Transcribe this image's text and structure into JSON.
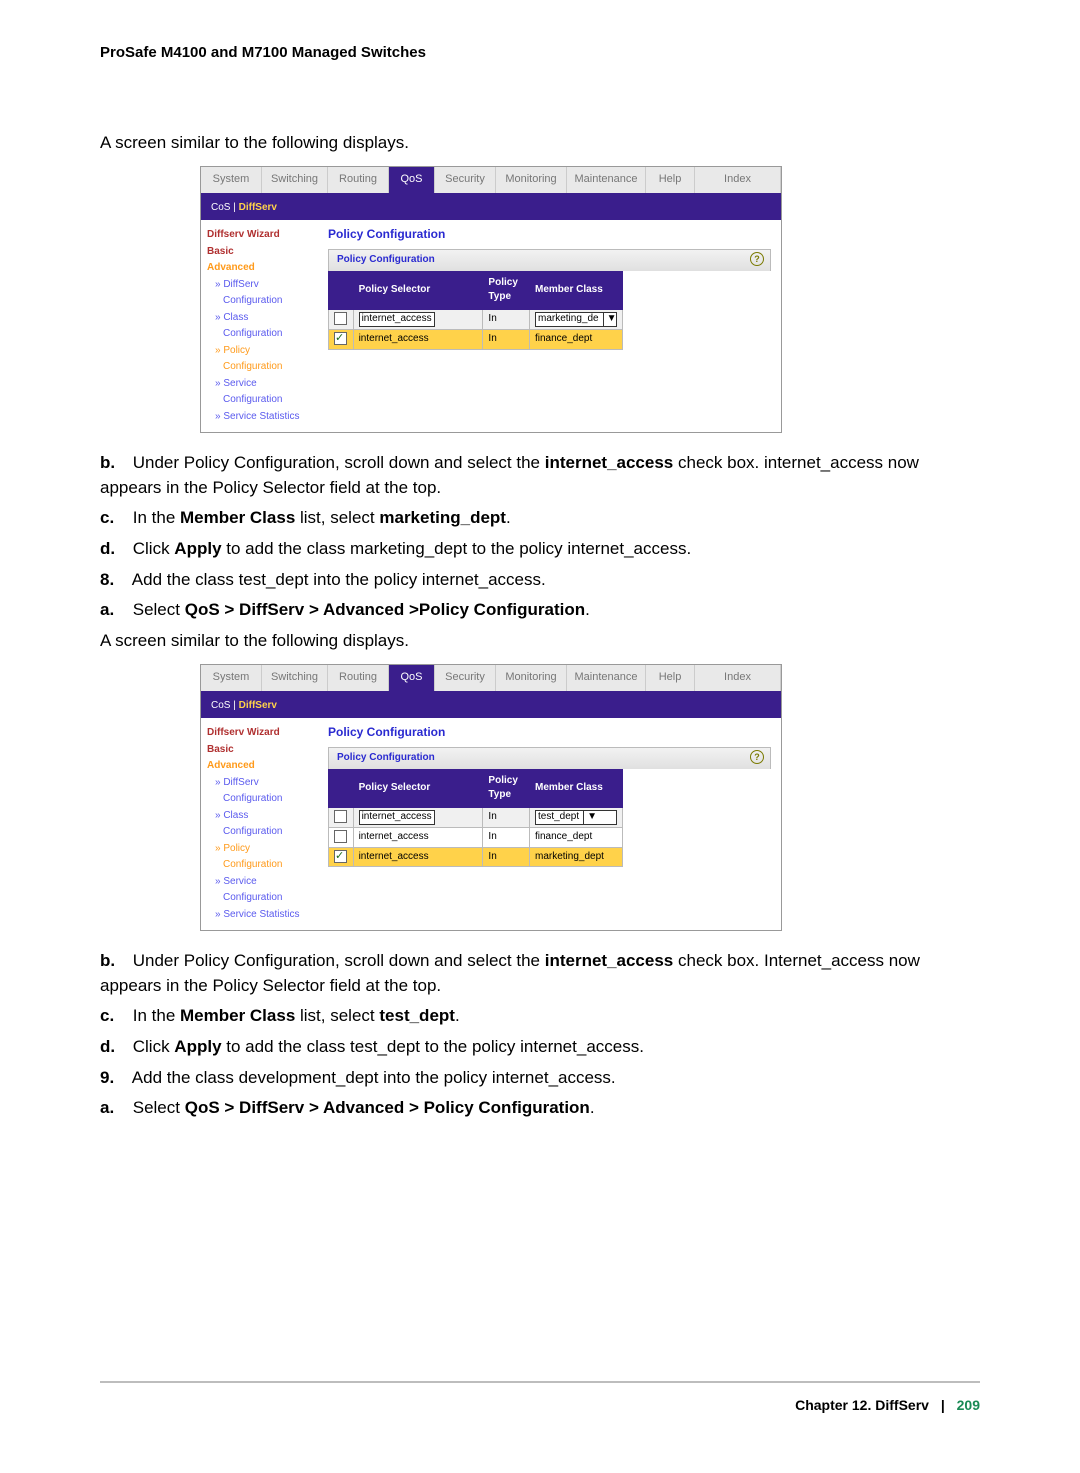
{
  "header": "ProSafe M4100 and M7100 Managed Switches",
  "intro1": "A screen similar to the following displays.",
  "tabbar": {
    "system": "System",
    "switching": "Switching",
    "routing": "Routing",
    "qos": "QoS",
    "security": "Security",
    "monitoring": "Monitoring",
    "maintenance": "Maintenance",
    "help": "Help",
    "index": "Index"
  },
  "subbar": {
    "cos": "CoS",
    "sep": "|",
    "diffserv": "DiffServ"
  },
  "sidebar": {
    "wizard": "Diffserv Wizard",
    "basic": "Basic",
    "advanced": "Advanced",
    "diffserv_cfg": "DiffServ Configuration",
    "class_cfg": "Class Configuration",
    "policy_cfg": "Policy Configuration",
    "service_cfg": "Service Configuration",
    "service_stats": "Service Statistics",
    "diffserv_pre": "» DiffServ",
    "class_pre": "» Class",
    "policy_pre": "» Policy",
    "service_pre": "» Service",
    "service_stats_pre": "» Service Statistics",
    "cfg_word": "Configuration"
  },
  "main_title": "Policy Configuration",
  "panel_title": "Policy Configuration",
  "cols": {
    "selector": "Policy Selector",
    "type": "Policy Type",
    "member": "Member Class"
  },
  "shot1": {
    "row_edit": {
      "selector": "internet_access",
      "type": "In",
      "member": "marketing_de"
    },
    "row_hl": {
      "selector": "internet_access",
      "type": "In",
      "member": "finance_dept"
    }
  },
  "step_b1_a": "Under Policy Configuration, scroll down and select the ",
  "step_b1_bold": "internet_access",
  "step_b1_b": " check box. internet_access now appears in the Policy Selector field at the top.",
  "step_c1_a": "In the ",
  "step_c1_bold1": "Member Class",
  "step_c1_b": " list, select ",
  "step_c1_bold2": "marketing_dept",
  "step_c1_c": ".",
  "step_d1_a": "Click ",
  "step_d1_bold": "Apply",
  "step_d1_b": " to add the class marketing_dept to the policy internet_access.",
  "step8": "Add the class test_dept into the policy internet_access.",
  "step8a_a": "Select ",
  "step8a_bold": "QoS > DiffServ > Advanced >Policy Configuration",
  "step8a_b": ".",
  "intro2": "A screen similar to the following displays.",
  "shot2": {
    "row_edit": {
      "selector": "internet_access",
      "type": "In",
      "member": "test_dept"
    },
    "row_plain": {
      "selector": "internet_access",
      "type": "In",
      "member": "finance_dept"
    },
    "row_hl": {
      "selector": "internet_access",
      "type": "In",
      "member": "marketing_dept"
    }
  },
  "step_b2_a": "Under Policy Configuration, scroll down and select the ",
  "step_b2_bold": "internet_access",
  "step_b2_b": " check box. Internet_access now appears in the Policy Selector field at the top.",
  "step_c2_a": "In the ",
  "step_c2_bold1": "Member Class",
  "step_c2_b": " list, select ",
  "step_c2_bold2": "test_dept",
  "step_c2_c": ".",
  "step_d2_a": "Click ",
  "step_d2_bold": "Apply",
  "step_d2_b": " to add the class test_dept to the policy internet_access.",
  "step9": "Add the class development_dept into the policy internet_access.",
  "step9a_a": "Select ",
  "step9a_bold": "QoS > DiffServ > Advanced > Policy Configuration",
  "step9a_b": ".",
  "labels": {
    "b": "b.",
    "c": "c.",
    "d": "d.",
    "n8": "8.",
    "a": "a.",
    "n9": "9."
  },
  "footer": {
    "chapter": "Chapter 12.  DiffServ",
    "sep": "|",
    "page": "209"
  },
  "help_q": "?"
}
